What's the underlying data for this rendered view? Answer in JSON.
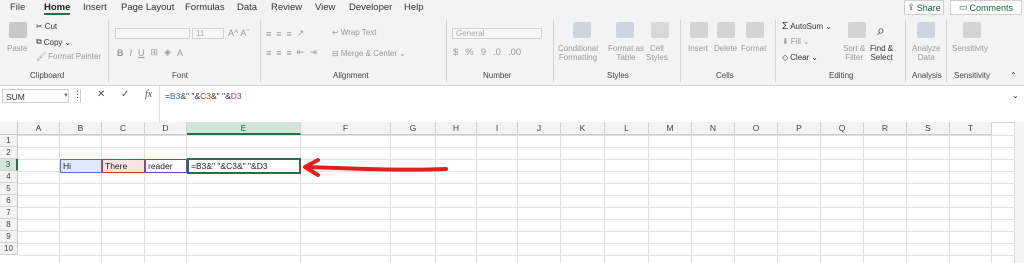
{
  "menu": {
    "tabs": [
      "File",
      "Home",
      "Insert",
      "Page Layout",
      "Formulas",
      "Data",
      "Review",
      "View",
      "Developer",
      "Help"
    ],
    "share": "Share",
    "comments": "Comments"
  },
  "ribbon": {
    "clipboard": {
      "label": "Clipboard",
      "paste": "Paste",
      "cut": "Cut",
      "copy": "Copy",
      "format_painter": "Format Painter"
    },
    "font": {
      "label": "Font",
      "font_name": "",
      "font_size": "11"
    },
    "alignment": {
      "label": "Alignment",
      "wrap_text": "Wrap Text",
      "merge_center": "Merge & Center"
    },
    "number": {
      "label": "Number",
      "format": "General"
    },
    "styles": {
      "label": "Styles",
      "conditional": "Conditional\nFormatting",
      "format_table": "Format as\nTable",
      "cell_styles": "Cell\nStyles"
    },
    "cells": {
      "label": "Cells",
      "insert": "Insert",
      "delete": "Delete",
      "format": "Format"
    },
    "editing": {
      "label": "Editing",
      "autosum": "AutoSum",
      "fill": "Fill",
      "clear": "Clear",
      "sort_filter": "Sort &\nFilter",
      "find_select": "Find &\nSelect"
    },
    "analysis": {
      "label": "Analysis",
      "analyze": "Analyze\nData"
    },
    "sensitivity": {
      "label": "Sensitivity",
      "btn": "Sensitivity"
    }
  },
  "formula_bar": {
    "name_box": "SUM",
    "formula_parts": [
      "=",
      "B3",
      "&\" \"&",
      "C3",
      "&\" \"&",
      "D3"
    ]
  },
  "grid": {
    "columns": [
      "A",
      "B",
      "C",
      "D",
      "E",
      "F",
      "G",
      "H",
      "I",
      "J",
      "K",
      "L",
      "M",
      "N",
      "O",
      "P",
      "Q",
      "R",
      "S",
      "T"
    ],
    "rows": [
      "1",
      "2",
      "3",
      "4",
      "5",
      "6",
      "7",
      "8",
      "9",
      "10"
    ],
    "cells": {
      "B3": "Hi",
      "C3": "There",
      "D3": "reader",
      "E3": "=B3&\" \"&C3&\" \"&D3"
    }
  },
  "colors": {
    "accent": "#217346",
    "ref1": "#4a6fd6",
    "ref2": "#c0392b",
    "ref3": "#7b3fbf",
    "arrow": "#e0201f"
  }
}
